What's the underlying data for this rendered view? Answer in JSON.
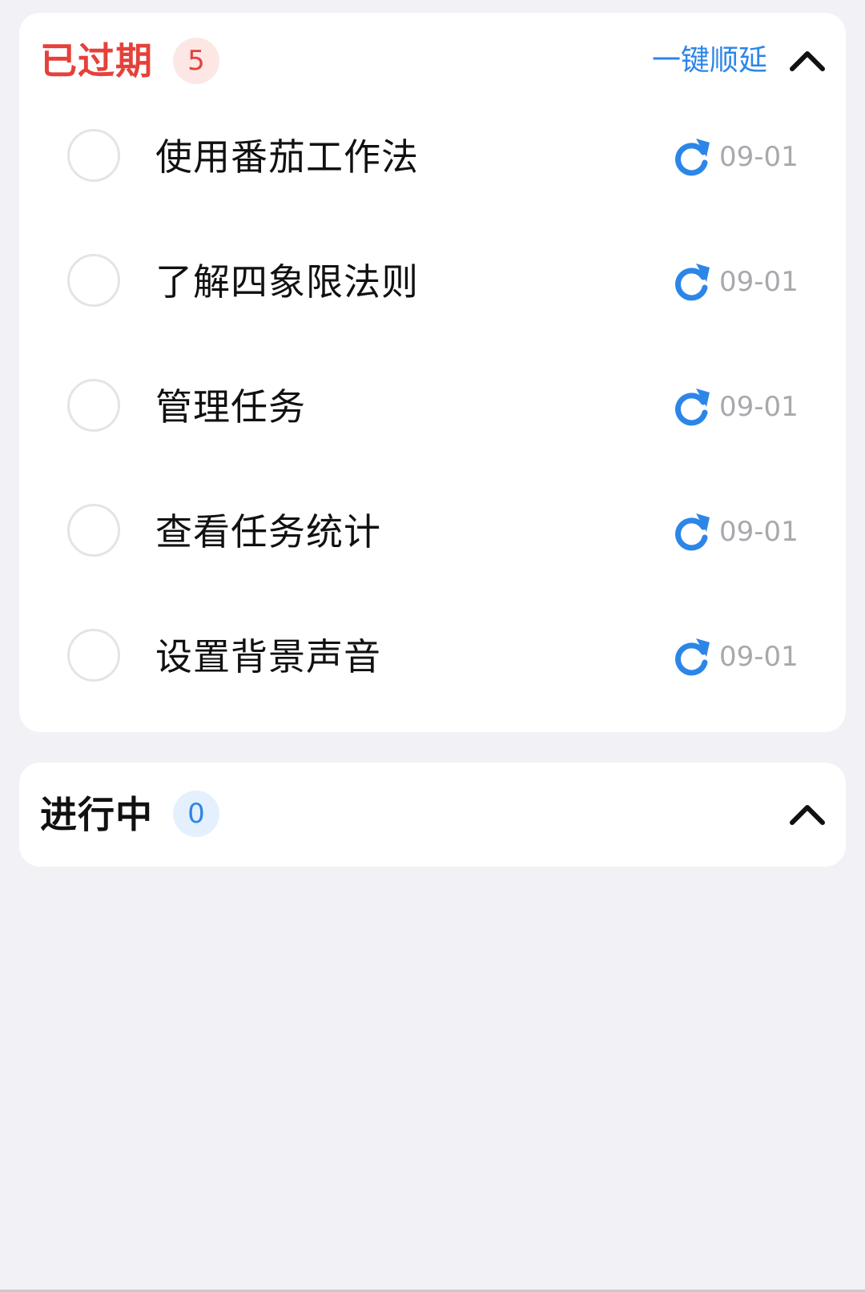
{
  "overdue": {
    "title": "已过期",
    "count": "5",
    "postpone_label": "一键顺延",
    "collapse_icon": "chevron-up-icon",
    "color": "#e5413a",
    "tasks": [
      {
        "title": "使用番茄工作法",
        "date": "09-01",
        "icon": "repeat-icon"
      },
      {
        "title": "了解四象限法则",
        "date": "09-01",
        "icon": "repeat-icon"
      },
      {
        "title": "管理任务",
        "date": "09-01",
        "icon": "repeat-icon"
      },
      {
        "title": "查看任务统计",
        "date": "09-01",
        "icon": "repeat-icon"
      },
      {
        "title": "设置背景声音",
        "date": "09-01",
        "icon": "repeat-icon"
      }
    ]
  },
  "in_progress": {
    "title": "进行中",
    "count": "0",
    "collapse_icon": "chevron-up-icon"
  },
  "colors": {
    "accent": "#2c86e8",
    "background": "#f1f1f6",
    "date_text": "#a8a8ad"
  }
}
